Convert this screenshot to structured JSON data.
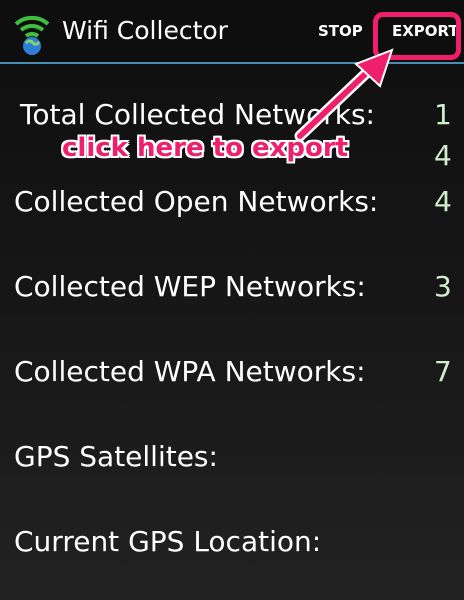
{
  "action_bar": {
    "title": "Wifi Collector",
    "stop_label": "STOP",
    "export_label": "EXPORT",
    "icon": "wifi-globe-icon"
  },
  "stats": [
    {
      "label": "Total Collected Networks:",
      "value": "1"
    },
    {
      "label": "Collected Open Networks:",
      "value": "4"
    },
    {
      "label": "Collected WEP Networks:",
      "value": "3"
    },
    {
      "label": "Collected WPA Networks:",
      "value": "7"
    },
    {
      "label": "GPS Satellites:",
      "value": ""
    },
    {
      "label": "Current GPS Location:",
      "value": ""
    }
  ],
  "total_second_line_value": "4",
  "annotation": {
    "text": "click here to export",
    "color": "#ef1f6c"
  },
  "colors": {
    "accent_line": "#4a8fb3",
    "value_text": "#cfeecb",
    "highlight": "#ef1f6c"
  }
}
